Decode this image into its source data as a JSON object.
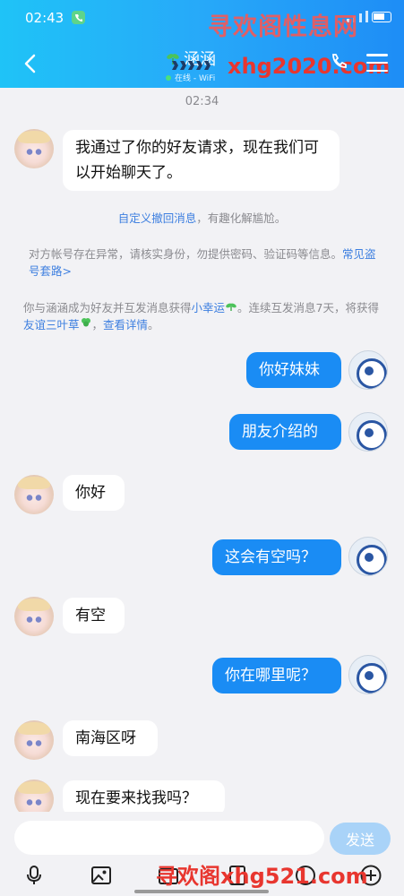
{
  "status_bar": {
    "time": "02:43"
  },
  "header": {
    "contact_name": "涵涵",
    "contact_status": "在线 - WiFi",
    "watermark_top": "寻欢阁性息网",
    "watermark_url": "xhg2020.com"
  },
  "chat": {
    "timestamp": "02:34",
    "system_notices": {
      "recall_link": "自定义撤回消息",
      "recall_tail": "，有趣化解尴尬。",
      "warning_text": "对方帐号存在异常，请核实身份，勿提供密码、验证码等信息。",
      "warning_link": "常见盗号套路>",
      "friend_prefix": "你与涵涵成为好友并互发消息获得",
      "friend_luck": "小幸运",
      "friend_mid": "。连续互发消息7天，将获得",
      "friend_clover": "友谊三叶草",
      "friend_sep": "，",
      "friend_details": "查看详情",
      "friend_end": "。"
    },
    "messages": [
      {
        "side": "in",
        "text": "我通过了你的好友请求，现在我们可以开始聊天了。"
      },
      {
        "side": "out",
        "text": "你好妹妹"
      },
      {
        "side": "out",
        "text": "朋友介绍的"
      },
      {
        "side": "in",
        "text": "你好"
      },
      {
        "side": "out",
        "text": "这会有空吗？"
      },
      {
        "side": "in",
        "text": "有空"
      },
      {
        "side": "out",
        "text": "你在哪里呢？"
      },
      {
        "side": "in",
        "text": "南海区呀"
      },
      {
        "side": "in",
        "text": "现在要来找我吗？"
      }
    ]
  },
  "input": {
    "placeholder": "",
    "send_label": "发送"
  },
  "footer": {
    "watermark": "寻欢阁xhg521.com"
  },
  "colors": {
    "accent": "#1a8cf4",
    "header_start": "#1fc3f7",
    "header_end": "#1e8df6",
    "link": "#3d7fe0"
  }
}
